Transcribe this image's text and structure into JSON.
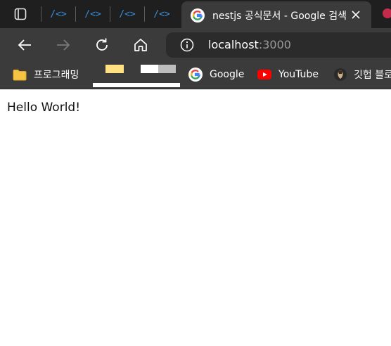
{
  "tabs": {
    "pinned": [
      {
        "glyph": "/<>"
      },
      {
        "glyph": "/<>"
      },
      {
        "glyph": "/<>"
      },
      {
        "glyph": "/<>"
      }
    ],
    "active": {
      "title": "nestjs 공식문서 - Google 검색",
      "favicon": "google-icon"
    }
  },
  "toolbar": {
    "url_host": "localhost",
    "url_port": ":3000"
  },
  "bookmarks": {
    "items": [
      {
        "label": "프로그래밍",
        "icon": "folder-icon"
      },
      {
        "label": "Google",
        "icon": "google-icon"
      },
      {
        "label": "YouTube",
        "icon": "youtube-icon"
      },
      {
        "label": "깃헙 블로",
        "icon": "avatar-icon"
      }
    ]
  },
  "page": {
    "body_text": "Hello World!"
  },
  "colors": {
    "chrome_dark": "#1f1f1f",
    "chrome": "#3b3b3b",
    "omnibox": "#2b2b2b",
    "pinned_tab": "#3b8fd9",
    "folder": "#f6c342",
    "youtube": "#ff0000"
  }
}
